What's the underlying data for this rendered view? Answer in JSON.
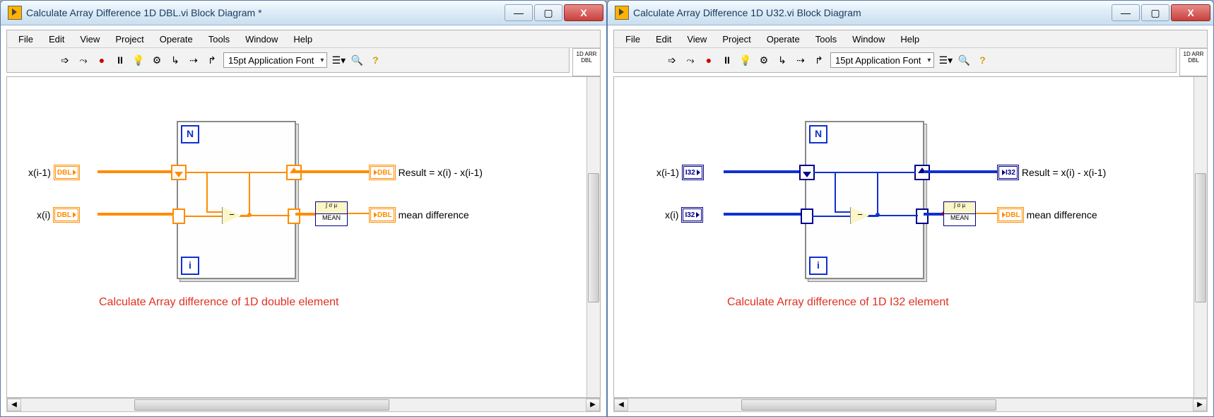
{
  "windows": [
    {
      "title": "Calculate Array Difference 1D DBL.vi Block Diagram *",
      "icon_label": "1D ARR\nDBL",
      "caption": "Calculate Array difference of 1D double element",
      "datatype_text": "DBL",
      "wire_class": "orange-w",
      "term_class": "orange",
      "ctrl_prev_label": "x(i-1)",
      "ctrl_curr_label": "x(i)",
      "ind_result_label": "Result = x(i) - x(i-1)",
      "ind_mean_label": "mean difference",
      "result_type_text": "DBL",
      "mean_type_text": "DBL"
    },
    {
      "title": "Calculate Array Difference 1D U32.vi Block Diagram",
      "icon_label": "1D ARR\nDBL",
      "caption": "Calculate Array difference of 1D I32 element",
      "datatype_text": "I32",
      "wire_class": "blue-w",
      "term_class": "blue",
      "ctrl_prev_label": "x(i-1)",
      "ctrl_curr_label": "x(i)",
      "ind_result_label": "Result = x(i) - x(i-1)",
      "ind_mean_label": "mean difference",
      "result_type_text": "I32",
      "mean_type_text": "DBL"
    }
  ],
  "menus": [
    "File",
    "Edit",
    "View",
    "Project",
    "Operate",
    "Tools",
    "Window",
    "Help"
  ],
  "font_display": "15pt Application Font",
  "loop_n": "N",
  "loop_i": "i",
  "mean_label": "MEAN",
  "mean_symbol": "∫ σ µ",
  "subtract_symbol": "−",
  "win_buttons": {
    "min": "—",
    "max": "▢",
    "close": "X"
  }
}
